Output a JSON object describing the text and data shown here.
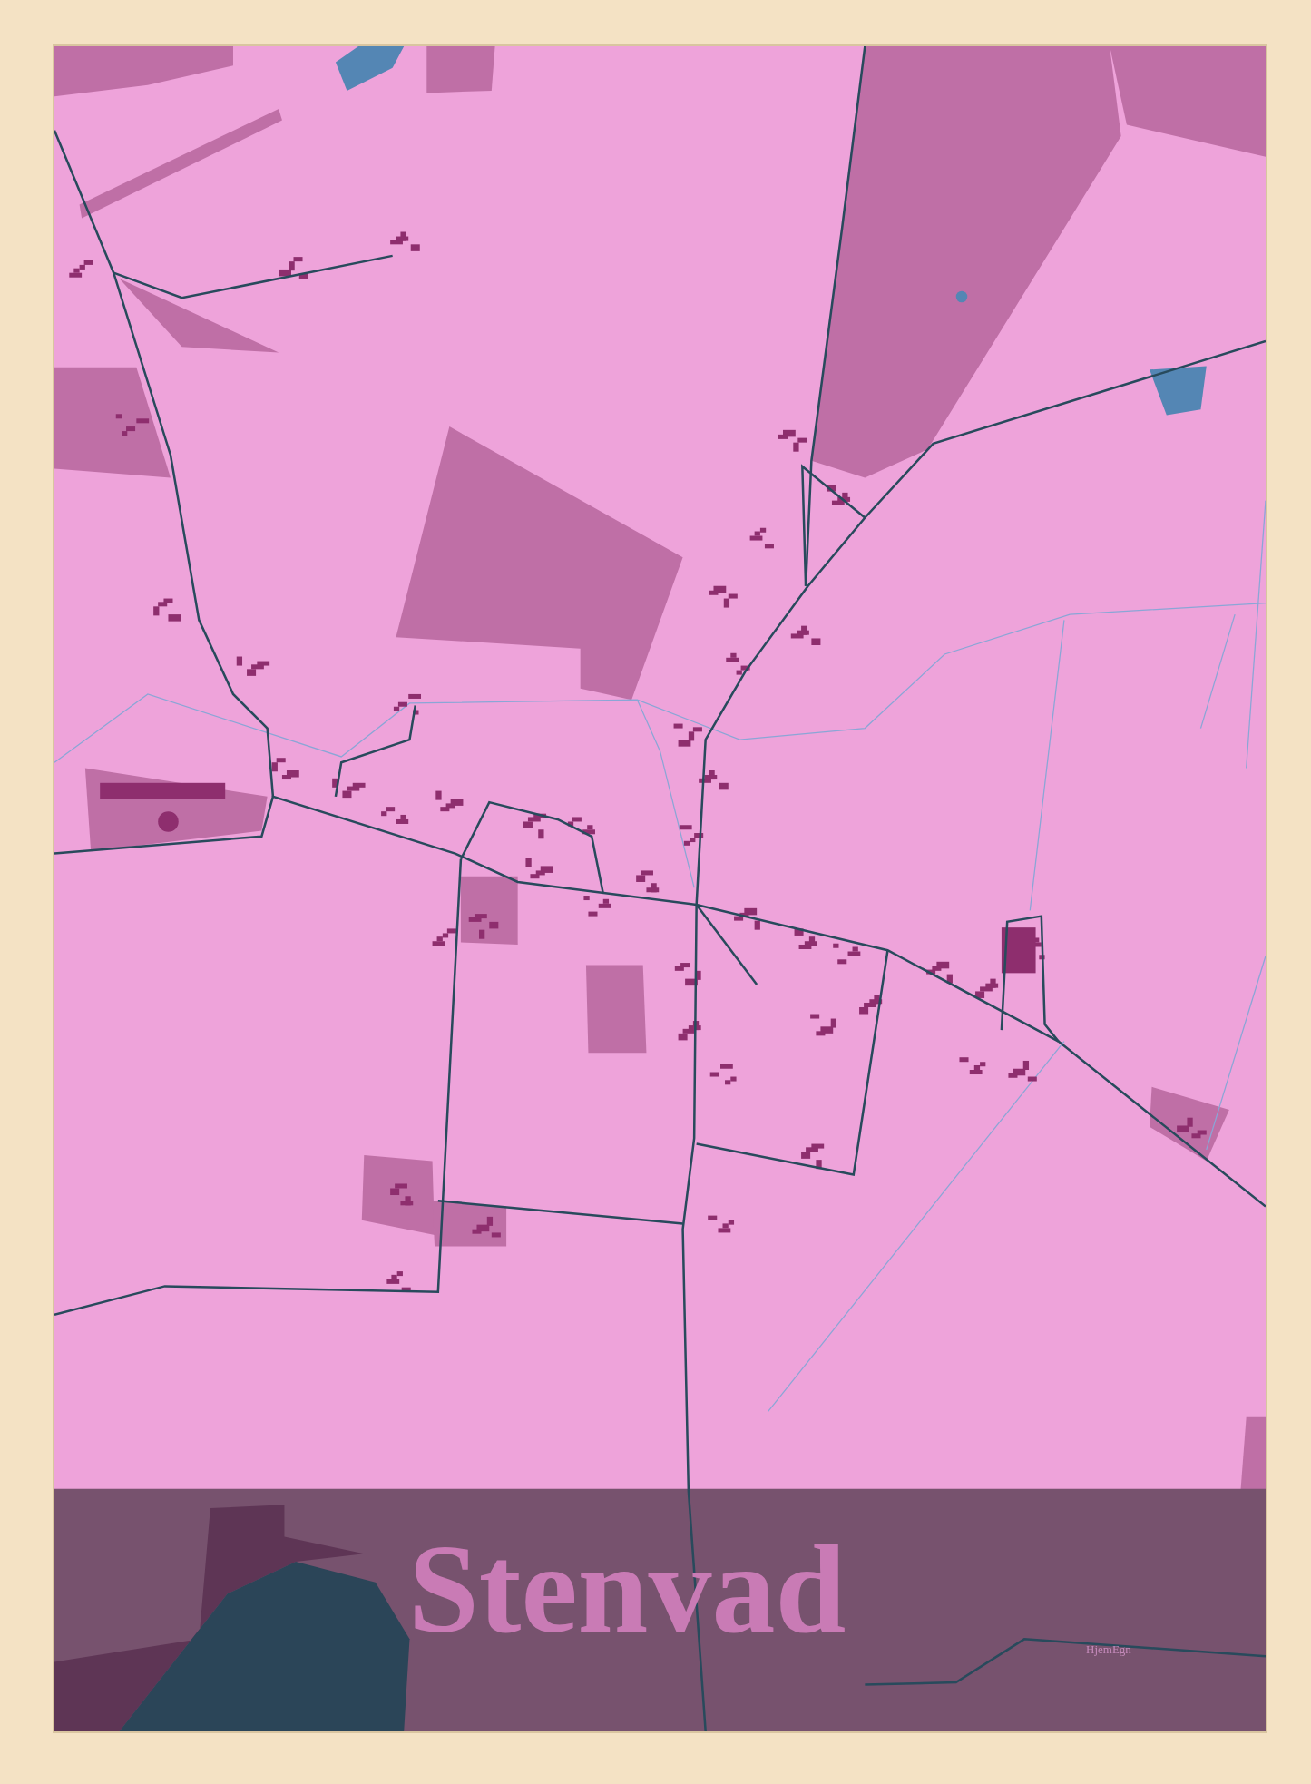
{
  "poster": {
    "title": "Stenvad",
    "brand": "HjemEgn"
  }
}
